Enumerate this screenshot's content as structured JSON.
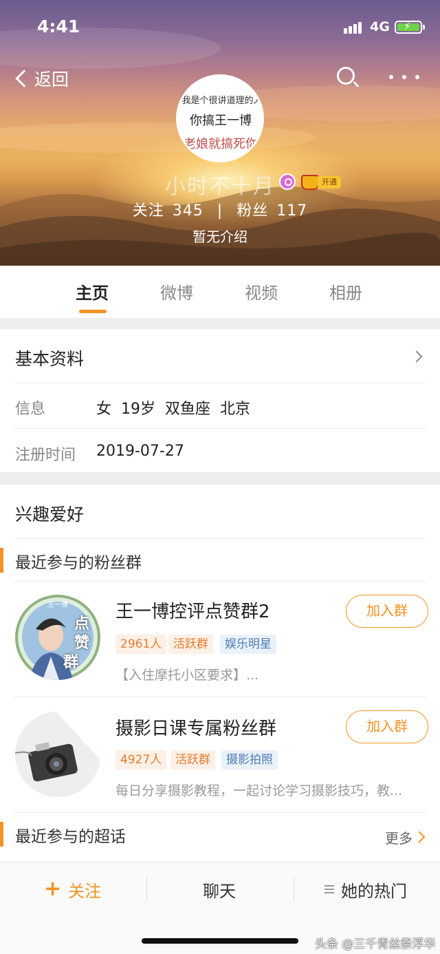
{
  "status_bar": {
    "time": "4:41",
    "network": "4G"
  },
  "nav": {
    "back_label": "返回"
  },
  "profile": {
    "avatar_text": [
      "我是个很讲道理的人",
      "你搞王一博",
      "老娘就搞死你"
    ],
    "nickname": "小时不十月",
    "vip_tag": "开通",
    "follow_label": "关注",
    "follow_count": "345",
    "separator": "|",
    "fans_label": "粉丝",
    "fans_count": "117",
    "intro": "暂无介绍"
  },
  "tabs": [
    {
      "label": "主页",
      "active": true
    },
    {
      "label": "微博",
      "active": false
    },
    {
      "label": "视频",
      "active": false
    },
    {
      "label": "相册",
      "active": false
    }
  ],
  "basic_info": {
    "title": "基本资料",
    "rows": [
      {
        "label": "信息",
        "value": "女  19岁  双鱼座  北京"
      },
      {
        "label": "注册时间",
        "value": "2019-07-27"
      }
    ]
  },
  "interests": {
    "title": "兴趣爱好",
    "fan_groups_title": "最近参与的粉丝群",
    "groups": [
      {
        "name": "王一博控评点赞群2",
        "avatar_caption": [
          "王一博",
          "点",
          "赞",
          "群"
        ],
        "tags": [
          "2961人",
          "活跃群",
          "娱乐明星"
        ],
        "desc": "【入住摩托小区要求】...",
        "join_label": "加入群"
      },
      {
        "name": "摄影日课专属粉丝群",
        "tags": [
          "4927人",
          "活跃群",
          "摄影拍照"
        ],
        "desc": "每日分享摄影教程，一起讨论学习摄影技巧，教...",
        "join_label": "加入群"
      }
    ],
    "super_topics_title": "最近参与的超话",
    "more_label": "更多"
  },
  "bottom_bar": {
    "follow_label": "关注",
    "chat_label": "聊天",
    "hot_label": "她的热门"
  },
  "watermark": "头条 @三千青丝祭浮华",
  "colors": {
    "accent": "#f39322",
    "tag_orange": "#e67f2e",
    "tag_blue": "#4f7cb4"
  }
}
